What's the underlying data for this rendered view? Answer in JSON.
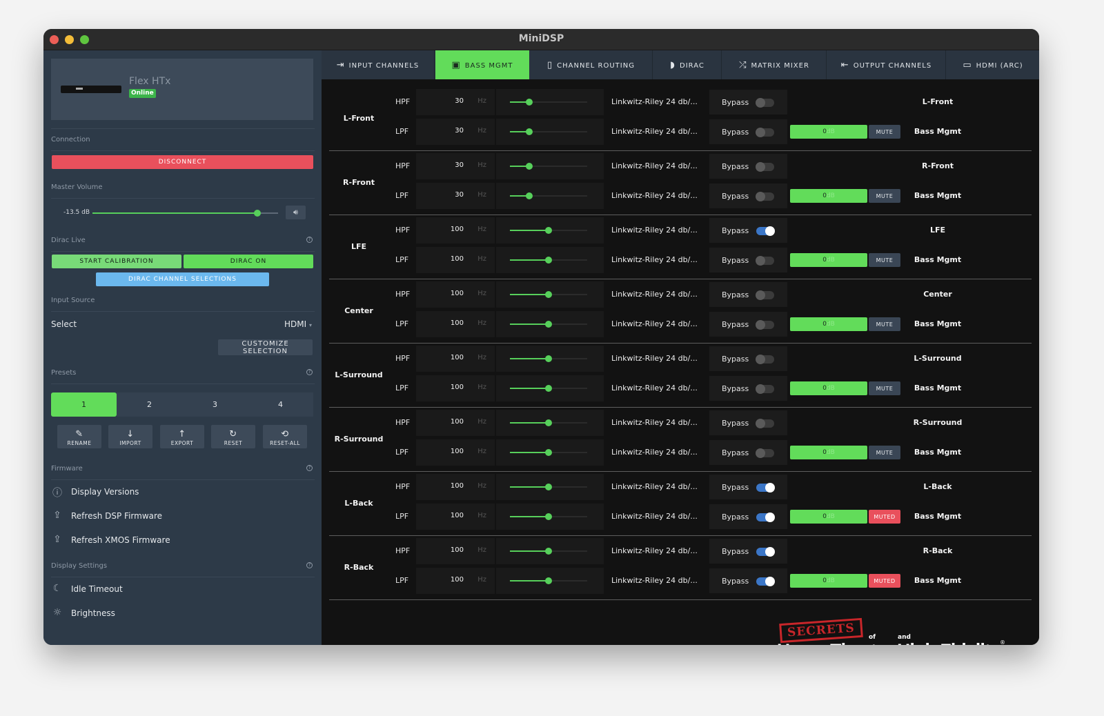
{
  "window": {
    "title": "MiniDSP"
  },
  "device": {
    "name": "Flex HTx",
    "status": "Online"
  },
  "connection": {
    "label": "Connection",
    "disconnect_label": "DISCONNECT"
  },
  "master_volume": {
    "label": "Master Volume",
    "value_text": "-13.5 dB",
    "level": 0.89
  },
  "dirac": {
    "label": "Dirac Live",
    "start_calibration": "START CALIBRATION",
    "dirac_on": "DIRAC ON",
    "channel_selections": "DIRAC CHANNEL SELECTIONS"
  },
  "input_source": {
    "label": "Input Source",
    "select_label": "Select",
    "value": "HDMI",
    "customize_label": "CUSTOMIZE SELECTION"
  },
  "presets": {
    "label": "Presets",
    "items": [
      "1",
      "2",
      "3",
      "4"
    ],
    "active": "1"
  },
  "preset_actions": [
    {
      "label": "RENAME",
      "icon": "edit-icon"
    },
    {
      "label": "IMPORT",
      "icon": "import-icon"
    },
    {
      "label": "EXPORT",
      "icon": "export-icon"
    },
    {
      "label": "RESET",
      "icon": "reset-icon"
    },
    {
      "label": "RESET-ALL",
      "icon": "reset-all-icon"
    }
  ],
  "firmware": {
    "label": "Firmware",
    "items": [
      {
        "label": "Display Versions",
        "icon": "info-icon"
      },
      {
        "label": "Refresh DSP Firmware",
        "icon": "upload-icon"
      },
      {
        "label": "Refresh XMOS Firmware",
        "icon": "upload-icon"
      }
    ]
  },
  "display_settings": {
    "label": "Display Settings",
    "items": [
      {
        "label": "Idle Timeout",
        "icon": "moon-icon"
      },
      {
        "label": "Brightness",
        "icon": "sun-icon"
      }
    ]
  },
  "tabs": [
    {
      "label": "INPUT CHANNELS",
      "icon": "input-icon"
    },
    {
      "label": "BASS MGMT",
      "icon": "bass-speaker-icon"
    },
    {
      "label": "CHANNEL ROUTING",
      "icon": "speaker-icon"
    },
    {
      "label": "DIRAC",
      "icon": "dirac-icon"
    },
    {
      "label": "MATRIX MIXER",
      "icon": "shuffle-icon"
    },
    {
      "label": "OUTPUT CHANNELS",
      "icon": "output-icon"
    },
    {
      "label": "HDMI (ARC)",
      "icon": "hdmi-icon"
    }
  ],
  "active_tab": "BASS MGMT",
  "bass_mgmt": {
    "hpf_label": "HPF",
    "lpf_label": "LPF",
    "unit": "Hz",
    "bypass_label": "Bypass",
    "gain_value": "0",
    "gain_unit": "dB",
    "bass_mgmt_label": "Bass Mgmt",
    "channels": [
      {
        "name": "L-Front",
        "hpf": {
          "freq": "30",
          "level": 0.25,
          "filter": "Linkwitz-Riley 24 db/...",
          "bypass": false
        },
        "lpf": {
          "freq": "30",
          "level": 0.25,
          "filter": "Linkwitz-Riley 24 db/...",
          "bypass": false
        },
        "mute": "MUTE",
        "muted": false
      },
      {
        "name": "R-Front",
        "hpf": {
          "freq": "30",
          "level": 0.25,
          "filter": "Linkwitz-Riley 24 db/...",
          "bypass": false
        },
        "lpf": {
          "freq": "30",
          "level": 0.25,
          "filter": "Linkwitz-Riley 24 db/...",
          "bypass": false
        },
        "mute": "MUTE",
        "muted": false
      },
      {
        "name": "LFE",
        "hpf": {
          "freq": "100",
          "level": 0.5,
          "filter": "Linkwitz-Riley 24 db/...",
          "bypass": true
        },
        "lpf": {
          "freq": "100",
          "level": 0.5,
          "filter": "Linkwitz-Riley 24 db/...",
          "bypass": false
        },
        "mute": "MUTE",
        "muted": false
      },
      {
        "name": "Center",
        "hpf": {
          "freq": "100",
          "level": 0.5,
          "filter": "Linkwitz-Riley 24 db/...",
          "bypass": false
        },
        "lpf": {
          "freq": "100",
          "level": 0.5,
          "filter": "Linkwitz-Riley 24 db/...",
          "bypass": false
        },
        "mute": "MUTE",
        "muted": false
      },
      {
        "name": "L-Surround",
        "hpf": {
          "freq": "100",
          "level": 0.5,
          "filter": "Linkwitz-Riley 24 db/...",
          "bypass": false
        },
        "lpf": {
          "freq": "100",
          "level": 0.5,
          "filter": "Linkwitz-Riley 24 db/...",
          "bypass": false
        },
        "mute": "MUTE",
        "muted": false
      },
      {
        "name": "R-Surround",
        "hpf": {
          "freq": "100",
          "level": 0.5,
          "filter": "Linkwitz-Riley 24 db/...",
          "bypass": false
        },
        "lpf": {
          "freq": "100",
          "level": 0.5,
          "filter": "Linkwitz-Riley 24 db/...",
          "bypass": false
        },
        "mute": "MUTE",
        "muted": false
      },
      {
        "name": "L-Back",
        "hpf": {
          "freq": "100",
          "level": 0.5,
          "filter": "Linkwitz-Riley 24 db/...",
          "bypass": true
        },
        "lpf": {
          "freq": "100",
          "level": 0.5,
          "filter": "Linkwitz-Riley 24 db/...",
          "bypass": true
        },
        "mute": "MUTED",
        "muted": true
      },
      {
        "name": "R-Back",
        "hpf": {
          "freq": "100",
          "level": 0.5,
          "filter": "Linkwitz-Riley 24 db/...",
          "bypass": true
        },
        "lpf": {
          "freq": "100",
          "level": 0.5,
          "filter": "Linkwitz-Riley 24 db/...",
          "bypass": true
        },
        "mute": "MUTED",
        "muted": true
      }
    ]
  },
  "watermark": {
    "secrets": "SECRETS",
    "of": "of",
    "and": "and",
    "main": "Home Theater High Fidelity",
    "reg": "®"
  },
  "colors": {
    "accent_green": "#62dc5a",
    "danger_red": "#e9505c",
    "info_blue": "#6bb8ee",
    "sidebar_bg": "#2d3a48",
    "toggle_on": "#3b76c7"
  }
}
